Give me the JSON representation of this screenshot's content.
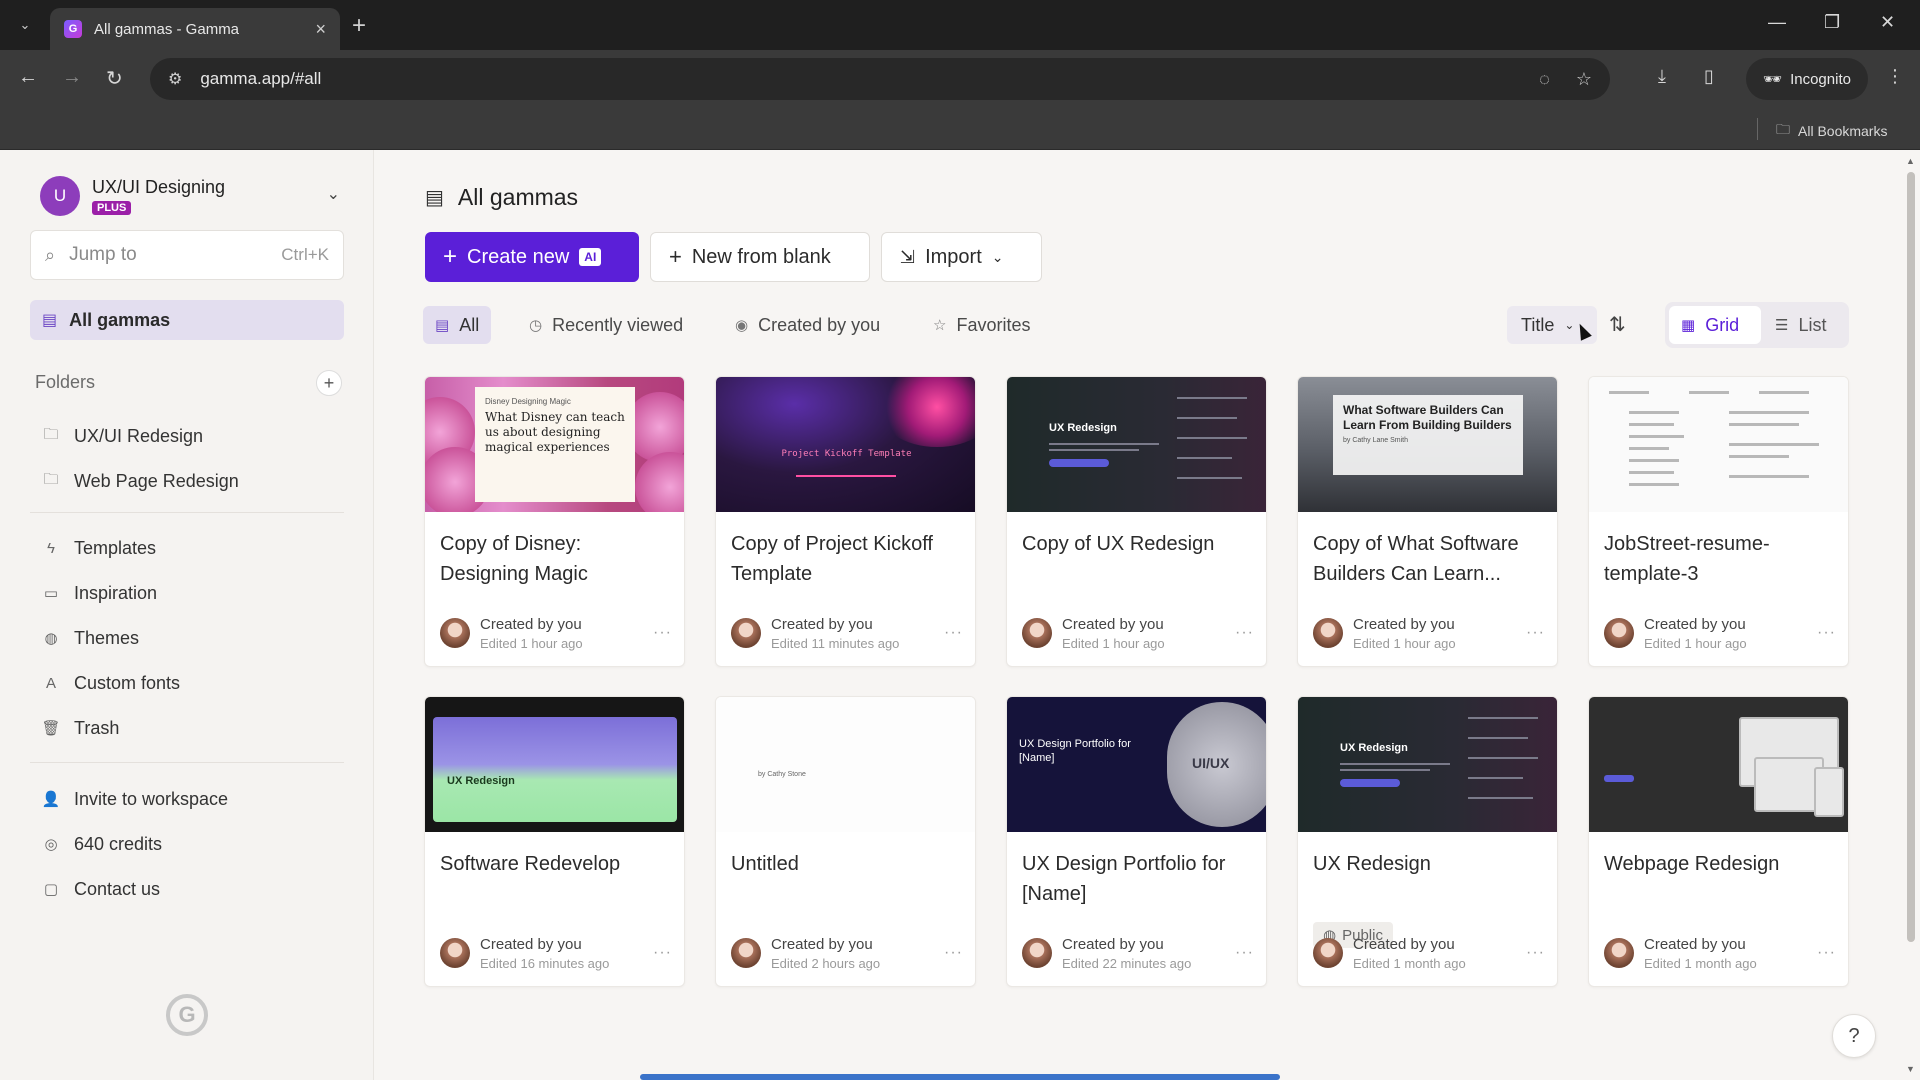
{
  "browser": {
    "tab_title": "All gammas - Gamma",
    "url": "gamma.app/#all",
    "incognito_label": "Incognito",
    "bookmarks_label": "All Bookmarks"
  },
  "sidebar": {
    "workspace_initial": "U",
    "workspace_name": "UX/UI Designing",
    "plan_badge": "PLUS",
    "jump_placeholder": "Jump to",
    "jump_shortcut": "Ctrl+K",
    "all_gammas": "All gammas",
    "folders_heading": "Folders",
    "folders": [
      "UX/UI Redesign",
      "Web Page Redesign"
    ],
    "links": [
      "Templates",
      "Inspiration",
      "Themes",
      "Custom fonts",
      "Trash"
    ],
    "footer_links": [
      "Invite to workspace",
      "640 credits",
      "Contact us"
    ]
  },
  "main": {
    "title": "All gammas",
    "create_new": "Create new",
    "ai_badge": "AI",
    "new_from_blank": "New from blank",
    "import": "Import",
    "filters": [
      "All",
      "Recently viewed",
      "Created by you",
      "Favorites"
    ],
    "sort_label": "Title",
    "view_grid": "Grid",
    "view_list": "List"
  },
  "thumb_text": {
    "disney_small": "Disney Designing Magic",
    "disney_big": "What Disney can teach us about designing magical experiences",
    "kickoff": "Project Kickoff Template",
    "ux": "UX Redesign",
    "software": "What Software Builders Can Learn From Building Builders",
    "software_by": "by Cathy Lane Smith",
    "softredev": "UX Redesign",
    "untitled_by": "by Cathy Stone",
    "portfolio": "UX Design Portfolio for [Name]",
    "portfolio_circle": "UI/UX",
    "uxr": "UX Redesign"
  },
  "cards": [
    {
      "title": "Copy of Disney: Designing Magic",
      "created": "Created by you",
      "edited": "Edited 1 hour ago"
    },
    {
      "title": "Copy of Project Kickoff Template",
      "created": "Created by you",
      "edited": "Edited 11 minutes ago"
    },
    {
      "title": "Copy of UX Redesign",
      "created": "Created by you",
      "edited": "Edited 1 hour ago"
    },
    {
      "title": "Copy of What Software Builders Can Learn...",
      "created": "Created by you",
      "edited": "Edited 1 hour ago"
    },
    {
      "title": "JobStreet-resume-template-3",
      "created": "Created by you",
      "edited": "Edited 1 hour ago"
    },
    {
      "title": "Software Redevelop",
      "created": "Created by you",
      "edited": "Edited 16 minutes ago"
    },
    {
      "title": "Untitled",
      "created": "Created by you",
      "edited": "Edited 2 hours ago"
    },
    {
      "title": "UX Design Portfolio for [Name]",
      "created": "Created by you",
      "edited": "Edited 22 minutes ago"
    },
    {
      "title": "UX Redesign",
      "created": "Created by you",
      "edited": "Edited 1 month ago",
      "badge": "Public"
    },
    {
      "title": "Webpage Redesign",
      "created": "Created by you",
      "edited": "Edited 1 month ago"
    }
  ],
  "help_label": "?",
  "colors": {
    "accent": "#5b1fd8",
    "active_bg": "#e3deef",
    "plan_badge": "#9b1fa8",
    "workspace_avatar": "#8d3dbb"
  }
}
